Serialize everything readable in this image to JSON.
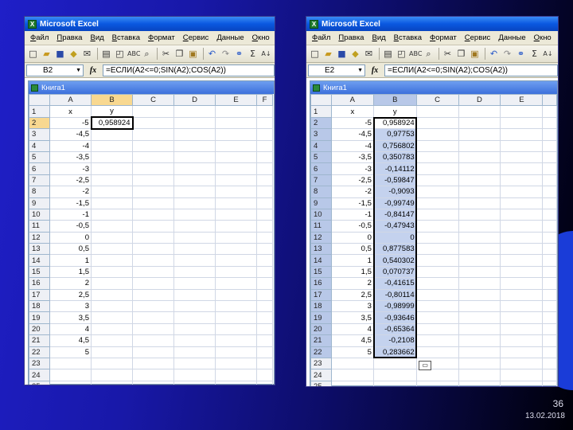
{
  "slide": {
    "number": "36",
    "date": "13.02.2018"
  },
  "left": {
    "app_title": "Microsoft Excel",
    "menu": [
      "Файл",
      "Правка",
      "Вид",
      "Вставка",
      "Формат",
      "Сервис",
      "Данные",
      "Окно"
    ],
    "namebox": "B2",
    "fx": "fx",
    "formula": "=ЕСЛИ(A2<=0;SIN(A2);COS(A2))",
    "workbook_title": "Книга1",
    "columns": [
      "A",
      "B",
      "C",
      "D",
      "E",
      "F"
    ],
    "rows": [
      [
        "1",
        "x",
        "y"
      ],
      [
        "2",
        "-5",
        "0,958924"
      ],
      [
        "3",
        "-4,5",
        ""
      ],
      [
        "4",
        "-4",
        ""
      ],
      [
        "5",
        "-3,5",
        ""
      ],
      [
        "6",
        "-3",
        ""
      ],
      [
        "7",
        "-2,5",
        ""
      ],
      [
        "8",
        "-2",
        ""
      ],
      [
        "9",
        "-1,5",
        ""
      ],
      [
        "10",
        "-1",
        ""
      ],
      [
        "11",
        "-0,5",
        ""
      ],
      [
        "12",
        "0",
        ""
      ],
      [
        "13",
        "0,5",
        ""
      ],
      [
        "14",
        "1",
        ""
      ],
      [
        "15",
        "1,5",
        ""
      ],
      [
        "16",
        "2",
        ""
      ],
      [
        "17",
        "2,5",
        ""
      ],
      [
        "18",
        "3",
        ""
      ],
      [
        "19",
        "3,5",
        ""
      ],
      [
        "20",
        "4",
        ""
      ],
      [
        "21",
        "4,5",
        ""
      ],
      [
        "22",
        "5",
        ""
      ],
      [
        "23",
        "",
        ""
      ],
      [
        "24",
        "",
        ""
      ],
      [
        "25",
        "",
        ""
      ]
    ]
  },
  "right": {
    "app_title": "Microsoft Excel",
    "menu": [
      "Файл",
      "Правка",
      "Вид",
      "Вставка",
      "Формат",
      "Сервис",
      "Данные",
      "Окно"
    ],
    "namebox": "E2",
    "fx": "fx",
    "formula": "=ЕСЛИ(A2<=0;SIN(A2);COS(A2))",
    "workbook_title": "Книга1",
    "columns": [
      "A",
      "B",
      "C",
      "D",
      "E"
    ],
    "rows": [
      [
        "1",
        "x",
        "y"
      ],
      [
        "2",
        "-5",
        "0,958924"
      ],
      [
        "3",
        "-4,5",
        "0,97753"
      ],
      [
        "4",
        "-4",
        "0,756802"
      ],
      [
        "5",
        "-3,5",
        "0,350783"
      ],
      [
        "6",
        "-3",
        "-0,14112"
      ],
      [
        "7",
        "-2,5",
        "-0,59847"
      ],
      [
        "8",
        "-2",
        "-0,9093"
      ],
      [
        "9",
        "-1,5",
        "-0,99749"
      ],
      [
        "10",
        "-1",
        "-0,84147"
      ],
      [
        "11",
        "-0,5",
        "-0,47943"
      ],
      [
        "12",
        "0",
        "0"
      ],
      [
        "13",
        "0,5",
        "0,877583"
      ],
      [
        "14",
        "1",
        "0,540302"
      ],
      [
        "15",
        "1,5",
        "0,070737"
      ],
      [
        "16",
        "2",
        "-0,41615"
      ],
      [
        "17",
        "2,5",
        "-0,80114"
      ],
      [
        "18",
        "3",
        "-0,98999"
      ],
      [
        "19",
        "3,5",
        "-0,93646"
      ],
      [
        "20",
        "4",
        "-0,65364"
      ],
      [
        "21",
        "4,5",
        "-0,2108"
      ],
      [
        "22",
        "5",
        "0,283662"
      ],
      [
        "23",
        "",
        ""
      ],
      [
        "24",
        "",
        ""
      ],
      [
        "25",
        "",
        ""
      ]
    ]
  },
  "toolbar_icons": [
    "new-icon",
    "open-icon",
    "save-icon",
    "permission-icon",
    "email-icon",
    "print-icon",
    "print-preview-icon",
    "spelling-icon",
    "research-icon",
    "cut-icon",
    "copy-icon",
    "paste-icon",
    "undo-icon",
    "redo-icon",
    "hyperlink-icon",
    "autosum-icon",
    "sort-asc-icon",
    "chart-wizard-icon"
  ],
  "colors": {
    "selected_range": "#c4d2ee",
    "header_selected": "#f8d890",
    "title_blue": "#0a58e0"
  }
}
